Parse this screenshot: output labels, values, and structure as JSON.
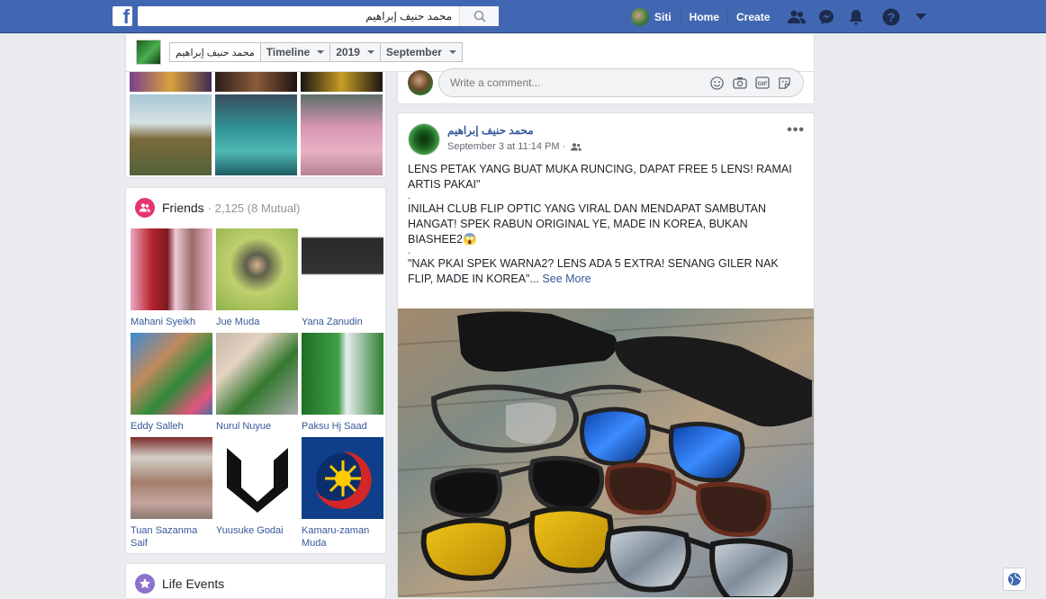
{
  "topbar": {
    "logo": "f",
    "search_value": "محمد حنيف إبراهيم",
    "user_name": "Siti",
    "home_label": "Home",
    "create_label": "Create"
  },
  "timeline_header": {
    "profile_name": "محمد حنيف إبراهيم",
    "tab_timeline": "Timeline",
    "tab_year": "2019",
    "tab_month": "September"
  },
  "friends": {
    "title": "Friends",
    "count": "· 2,125 (8 Mutual)",
    "list": [
      {
        "name": "Mahani Syeikh"
      },
      {
        "name": "Jue Muda"
      },
      {
        "name": "Yana Zanudin"
      },
      {
        "name": "Eddy Salleh"
      },
      {
        "name": "Nurul Nuyue"
      },
      {
        "name": "Paksu Hj Saad"
      },
      {
        "name": "Tuan Sazanma Saif"
      },
      {
        "name": "Yuusuke Godai"
      },
      {
        "name": "Kamaru-zaman Muda"
      }
    ]
  },
  "life_events": {
    "title": "Life Events"
  },
  "comment": {
    "placeholder": "Write a comment..."
  },
  "post": {
    "author": "محمد حنيف إبراهيم",
    "date": "September 3 at 11:14 PM ·",
    "para1": "LENS PETAK YANG BUAT MUKA RUNCING, DAPAT FREE 5 LENS! RAMAI ARTIS PAKAI\"",
    "para2": "INILAH CLUB FLIP OPTIC YANG VIRAL DAN MENDAPAT SAMBUTAN HANGAT! SPEK RABUN ORIGINAL YE, MADE IN KOREA, BUKAN BIASHEE2😱",
    "para3": "\"NAK PKAI SPEK WARNA2? LENS ADA 5 EXTRA! SENANG GILER NAK FLIP, MADE IN KOREA\"...",
    "see_more": "See More",
    "dot": "."
  },
  "colors": {
    "brand": "#4267b2",
    "link": "#365899",
    "friends_icon": "#e63573",
    "life_icon": "#8c72cb"
  },
  "icons": [
    "search-icon",
    "friend-requests-icon",
    "messenger-icon",
    "notifications-icon",
    "help-icon",
    "account-menu-icon",
    "emoji-icon",
    "camera-icon",
    "gif-icon",
    "sticker-icon",
    "audience-friends-icon",
    "more-options-icon",
    "globe-icon"
  ]
}
